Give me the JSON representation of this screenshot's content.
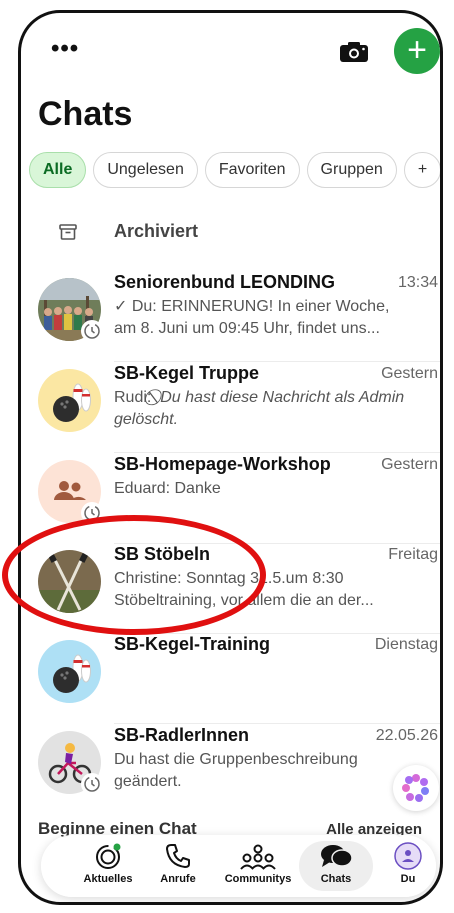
{
  "header": {
    "menu_label": "•••",
    "title": "Chats",
    "new_chat_label": "+"
  },
  "filters": [
    {
      "label": "Alle",
      "active": true
    },
    {
      "label": "Ungelesen",
      "active": false
    },
    {
      "label": "Favoriten",
      "active": false
    },
    {
      "label": "Gruppen",
      "active": false
    },
    {
      "label": "+",
      "active": false
    }
  ],
  "archived": {
    "label": "Archiviert"
  },
  "chats": [
    {
      "name": "Seniorenbund LEONDING",
      "time": "13:34",
      "sender": "✓ Du: ",
      "preview": "ERINNERUNG! In einer Woche, am 8. Juni um 09:45 Uhr, findet uns...",
      "avatar": "group-photo"
    },
    {
      "name": "SB-Kegel Truppe",
      "time": "Gestern",
      "sender": "Rudi: ",
      "preview": "⃠ Du hast diese Nachricht als Admin gelöscht.",
      "avatar": "bowling-icon"
    },
    {
      "name": "SB-Homepage-Workshop",
      "time": "Gestern",
      "sender": "Eduard: ",
      "preview": "Danke",
      "avatar": "group-placeholder-icon"
    },
    {
      "name": "SB Stöbeln",
      "time": "Freitag",
      "sender": "Christine: ",
      "preview": "Sonntag 31.5.um  8:30 Stöbeltraining, vor allem die an der...",
      "avatar": "poles-photo"
    },
    {
      "name": "SB-Kegel-Training",
      "time": "Dienstag",
      "sender": "",
      "preview": "",
      "avatar": "bowling-icon"
    },
    {
      "name": "SB-RadlerInnen",
      "time": "22.05.26",
      "sender": "",
      "preview": "Du hast die Gruppenbeschreibung geändert.",
      "avatar": "cyclist-icon"
    }
  ],
  "start_chat": {
    "label": "Beginne einen Chat",
    "show_all": "Alle anzeigen"
  },
  "tabs": [
    {
      "label": "Aktuelles",
      "icon": "status-icon"
    },
    {
      "label": "Anrufe",
      "icon": "phone-icon"
    },
    {
      "label": "Communitys",
      "icon": "communities-icon"
    },
    {
      "label": "Chats",
      "icon": "chat-bubbles-icon",
      "active": true
    },
    {
      "label": "Du",
      "icon": "profile-icon"
    }
  ],
  "colors": {
    "accent_green": "#25a244",
    "chip_active_bg": "#d9f6d8",
    "highlight_red": "#e01010"
  }
}
